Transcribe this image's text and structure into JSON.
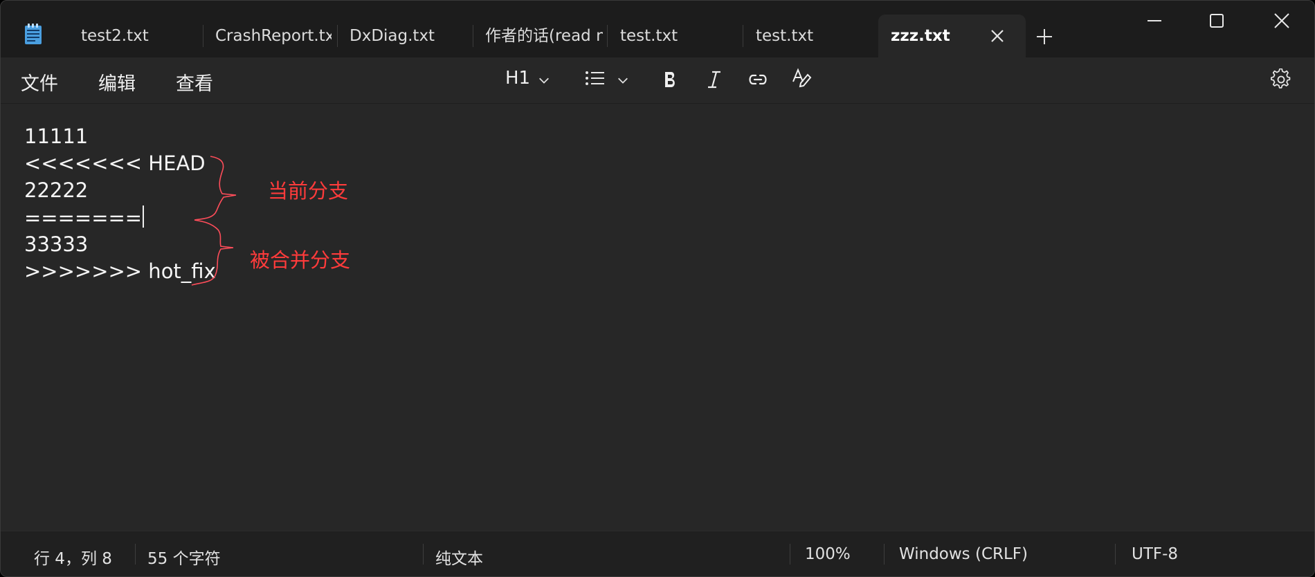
{
  "window": {
    "tabs": [
      {
        "label": "test2.txt"
      },
      {
        "label": "CrashReport.txt"
      },
      {
        "label": "DxDiag.txt"
      },
      {
        "label": "作者的话(read n"
      },
      {
        "label": "test.txt"
      },
      {
        "label": "test.txt"
      },
      {
        "label": "zzz.txt",
        "active": true
      }
    ],
    "icons": {
      "app": "notepad-icon",
      "close_tab": "close-icon",
      "new_tab": "plus-icon",
      "minimize": "minimize-icon",
      "maximize": "maximize-icon",
      "close": "close-icon"
    }
  },
  "toolbar": {
    "menus": [
      "文件",
      "编辑",
      "查看"
    ],
    "heading": "H1",
    "icons": [
      "chevron-down-icon",
      "list-icon",
      "bold-icon",
      "italic-icon",
      "link-icon",
      "spellcheck-icon",
      "gear-icon"
    ]
  },
  "editor": {
    "lines": [
      "11111",
      "<<<<<<< HEAD",
      "22222",
      "=======",
      "33333",
      ">>>>>>> hot_fix"
    ],
    "annotations": [
      "当前分支",
      "被合并分支"
    ],
    "annotation_color": "#ff3b3b"
  },
  "status": {
    "position": "行 4，列 8",
    "chars": "55 个字符",
    "format": "纯文本",
    "zoom": "100%",
    "line_ending": "Windows (CRLF)",
    "encoding": "UTF-8"
  }
}
